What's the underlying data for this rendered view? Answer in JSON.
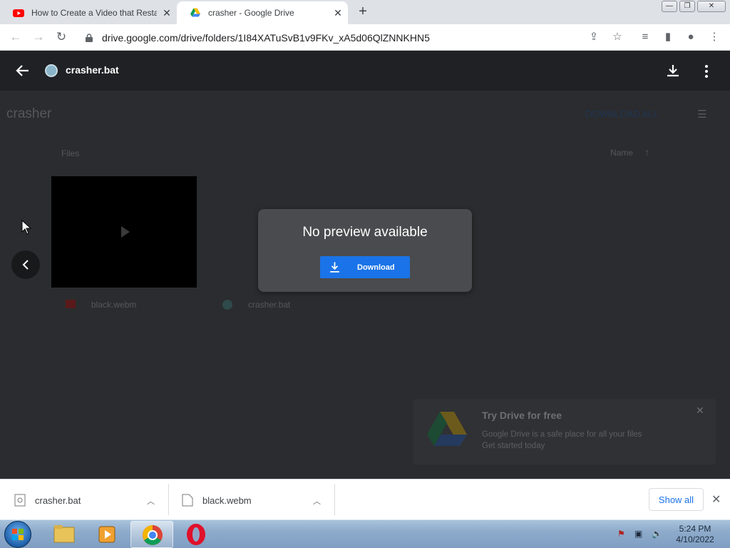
{
  "browser": {
    "tabs": [
      {
        "title": "How to Create a Video that Resta",
        "favicon": "youtube-icon",
        "active": false
      },
      {
        "title": "crasher - Google Drive",
        "favicon": "google-drive-icon",
        "active": true
      }
    ],
    "url": "drive.google.com/drive/folders/1I84XATuSvB1v9FKv_xA5d06QlZNNKHN5"
  },
  "background_page": {
    "folder_title": "crasher",
    "download_all": "DOWNLOAD ALL",
    "files_label": "Files",
    "sort_label": "Name",
    "files": [
      {
        "name": "black.webm"
      },
      {
        "name": "crasher.bat"
      }
    ]
  },
  "preview": {
    "file_name": "crasher.bat",
    "message": "No preview available",
    "download_label": "Download"
  },
  "promo": {
    "title": "Try Drive for free",
    "body_line1": "Google Drive is a safe place for all your files",
    "body_line2": "Get started today"
  },
  "downloads": {
    "items": [
      {
        "name": "crasher.bat"
      },
      {
        "name": "black.webm"
      }
    ],
    "show_all": "Show all"
  },
  "taskbar": {
    "time": "5:24 PM",
    "date": "4/10/2022"
  },
  "colors": {
    "accent_blue": "#1a73e8",
    "preview_backdrop": "#202124",
    "dialog_bg": "#4a4b4e"
  }
}
